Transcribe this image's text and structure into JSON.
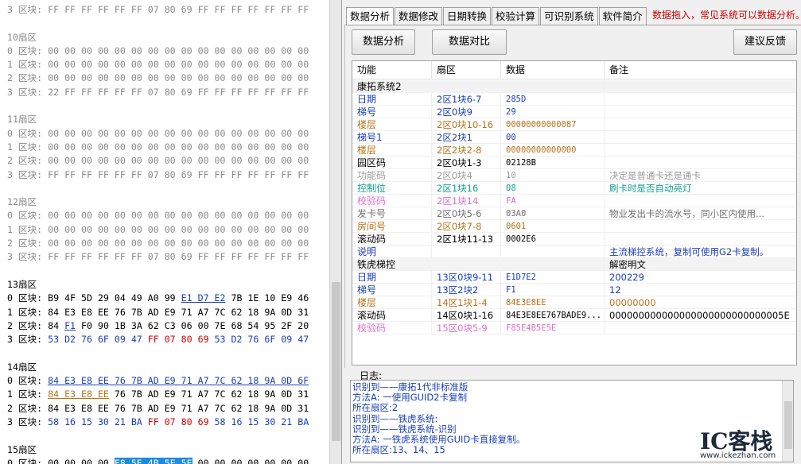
{
  "hex": {
    "lines": [
      {
        "t": "row",
        "label": "3 区块:",
        "bytes": "FF FF FF FF FF FF 07 80 69 FF FF FF FF FF FF FF",
        "style": "gray"
      },
      {
        "t": "blank"
      },
      {
        "t": "sector",
        "label": "10扇区"
      },
      {
        "t": "row",
        "label": "0 区块:",
        "bytes": "00 00 00 00 00 00 00 00 00 00 00 00 00 00 00 00",
        "style": "gray"
      },
      {
        "t": "row",
        "label": "1 区块:",
        "bytes": "00 00 00 00 00 00 00 00 00 00 00 00 00 00 00 00",
        "style": "gray"
      },
      {
        "t": "row",
        "label": "2 区块:",
        "bytes": "00 00 00 00 00 00 00 00 00 00 00 00 00 00 00 00",
        "style": "gray"
      },
      {
        "t": "row",
        "label": "3 区块:",
        "bytes": "22 FF FF FF FF FF 07 80 69 FF FF FF FF FF FF FF",
        "style": "gray"
      },
      {
        "t": "blank"
      },
      {
        "t": "sector",
        "label": "11扇区"
      },
      {
        "t": "row",
        "label": "0 区块:",
        "bytes": "00 00 00 00 00 00 00 00 00 00 00 00 00 00 00 00",
        "style": "gray"
      },
      {
        "t": "row",
        "label": "1 区块:",
        "bytes": "00 00 00 00 00 00 00 00 00 00 00 00 00 00 00 00",
        "style": "gray"
      },
      {
        "t": "row",
        "label": "2 区块:",
        "bytes": "00 00 00 00 00 00 00 00 00 00 00 00 00 00 00 00",
        "style": "gray"
      },
      {
        "t": "row",
        "label": "3 区块:",
        "bytes": "FF FF FF FF FF FF 07 80 69 FF FF FF FF FF FF FF",
        "style": "gray"
      },
      {
        "t": "blank"
      },
      {
        "t": "sector",
        "label": "12扇区"
      },
      {
        "t": "row",
        "label": "0 区块:",
        "bytes": "00 00 00 00 00 00 00 00 00 00 00 00 00 00 00 00",
        "style": "gray"
      },
      {
        "t": "row",
        "label": "1 区块:",
        "bytes": "00 00 00 00 00 00 00 00 00 00 00 00 00 00 00 00",
        "style": "gray"
      },
      {
        "t": "row",
        "label": "2 区块:",
        "bytes": "00 00 00 00 00 00 00 00 00 00 00 00 00 00 00 00",
        "style": "gray"
      },
      {
        "t": "row",
        "label": "3 区块:",
        "bytes": "FF FF FF FF FF FF 07 80 69 FF FF FF FF FF FF FF",
        "style": "gray"
      },
      {
        "t": "blank"
      },
      {
        "t": "sector",
        "label": "13扇区",
        "style": "dark"
      },
      {
        "t": "seg",
        "label": "0 区块:",
        "segs": [
          [
            "B9 4F 5D 29 04 49 A0 99 ",
            ""
          ],
          [
            "E1 D7 E2",
            "ul"
          ],
          [
            " 7B 1E 10 E9 46",
            ""
          ]
        ]
      },
      {
        "t": "seg",
        "label": "1 区块:",
        "segs": [
          [
            "84 E3 E8 EE 76 7B AD E9 71 A7 7C 62 18 9A 0D 31",
            ""
          ]
        ]
      },
      {
        "t": "seg",
        "label": "2 区块:",
        "segs": [
          [
            "84 ",
            ""
          ],
          [
            "F1",
            "ul"
          ],
          [
            " F0 90 1B 3A 62 C3 06 00 7E 68 54 95 2F 20",
            ""
          ]
        ]
      },
      {
        "t": "seg",
        "label": "3 区块:",
        "segs": [
          [
            "53 D2 76 6F 09 47 ",
            "blue"
          ],
          [
            "FF 07 80 69",
            "red"
          ],
          [
            " 53 D2 76 6F 09 47",
            "blue"
          ]
        ]
      },
      {
        "t": "blank"
      },
      {
        "t": "sector",
        "label": "14扇区",
        "style": "dark"
      },
      {
        "t": "seg",
        "label": "0 区块:",
        "segs": [
          [
            "84 E3 E8 EE 76 7B AD E9 71 A7 7C 62 18 9A 0D 6F",
            "ul"
          ]
        ]
      },
      {
        "t": "seg",
        "label": "1 区块:",
        "segs": [
          [
            "84 E3 E8 EE",
            "gold"
          ],
          [
            " 76 7B AD E9 71 A7 7C 62 18 9A 0D 31",
            ""
          ]
        ]
      },
      {
        "t": "seg",
        "label": "2 区块:",
        "segs": [
          [
            "84 E3 E8 EE 76 7B AD E9 71 A7 7C 62 18 9A 0D 31",
            ""
          ]
        ]
      },
      {
        "t": "seg",
        "label": "3 区块:",
        "segs": [
          [
            "58 16 15 30 21 BA ",
            "blue"
          ],
          [
            "FF 07 80 69",
            "red"
          ],
          [
            " 58 16 15 30 21 BA",
            "blue"
          ]
        ]
      },
      {
        "t": "blank"
      },
      {
        "t": "sector",
        "label": "15扇区",
        "style": "dark"
      },
      {
        "t": "seg",
        "label": "0 区块:",
        "segs": [
          [
            "00 00 00 00 ",
            ""
          ],
          [
            "F8 5E 4B 5E 5E",
            "sel"
          ],
          [
            " 00 00 00 00 00 00 00",
            ""
          ]
        ]
      }
    ]
  },
  "tabs": [
    "数据分析",
    "数据修改",
    "日期转换",
    "校验计算",
    "可识别系统",
    "软件简介"
  ],
  "hint": "数据拖入，常见系统可以数据分析。",
  "buttons": {
    "analyze": "数据分析",
    "compare": "数据对比",
    "feedback": "建议反馈"
  },
  "grid": {
    "headers": [
      "功能",
      "扇区",
      "数据",
      "备注"
    ],
    "rows": [
      {
        "section": true,
        "c1": "康拓系统2",
        "color": "#000000"
      },
      {
        "c1": "日期",
        "c2": "2区1块6-7",
        "c3": "285D",
        "c4": "",
        "color": "#1a3fb4"
      },
      {
        "c1": "梯号",
        "c2": "2区0块9",
        "c3": "29",
        "c4": "",
        "color": "#1a3fb4"
      },
      {
        "c1": "楼层",
        "c2": "2区0块10-16",
        "c3": "00000000000087",
        "c4": "",
        "color": "#b8741a"
      },
      {
        "c1": "梯号1",
        "c2": "2区2块1",
        "c3": "00",
        "c4": "",
        "color": "#1a3fb4"
      },
      {
        "c1": "楼层",
        "c2": "2区2块2-8",
        "c3": "00000000000000",
        "c4": "",
        "color": "#b8741a"
      },
      {
        "c1": "园区码",
        "c2": "2区0块1-3",
        "c3": "02128B",
        "c4": "",
        "color": "#000000"
      },
      {
        "c1": "功能码",
        "c2": "2区0块4",
        "c3": "10",
        "c4": "决定是普通卡还是通卡",
        "color": "#9a9a9a"
      },
      {
        "c1": "控制位",
        "c2": "2区1块16",
        "c3": "08",
        "c4": "刷卡时是否自动亮灯",
        "color": "#10a090"
      },
      {
        "c1": "校验码",
        "c2": "2区1块14",
        "c3": "FA",
        "c4": "",
        "color": "#e070d0"
      },
      {
        "c1": "发卡号",
        "c2": "2区0块5-6",
        "c3": "03A0",
        "c4": " 物业发出卡的流水号，同小区内使用...",
        "color": "#707070"
      },
      {
        "c1": "房间号",
        "c2": "2区0块7-8",
        "c3": "0601",
        "c4": "",
        "color": "#b8741a"
      },
      {
        "c1": "滚动码",
        "c2": "2区1块11-13",
        "c3": "0002E6",
        "c4": "",
        "color": "#000000"
      },
      {
        "c1": "说明",
        "c2": "",
        "c3": "",
        "c4": "主流梯控系统，复制可使用G2卡复制。",
        "color": "#1a3fb4"
      },
      {
        "section": true,
        "c1": "铁虎梯控",
        "c4": "解密明文",
        "color": "#000000"
      },
      {
        "c1": "日期",
        "c2": "13区0块9-11",
        "c3": "E1D7E2",
        "c4": "200229",
        "color": "#1a3fb4"
      },
      {
        "c1": "梯号",
        "c2": "13区2块2",
        "c3": "F1",
        "c4": "12",
        "color": "#1a3fb4"
      },
      {
        "c1": "楼层",
        "c2": "14区1块1-4",
        "c3": "84E3E8EE",
        "c4": "00000000",
        "color": "#b8741a"
      },
      {
        "c1": "滚动码",
        "c2": "14区0块1-16",
        "c3": "84E3E8EE767BADE9...",
        "c4": "000000000000000000000000000005E",
        "color": "#000000"
      },
      {
        "c1": "校验码",
        "c2": "15区0块5-9",
        "c3": "F85E4B5E5E",
        "c4": "",
        "color": "#e070d0"
      }
    ]
  },
  "log": {
    "label": "日志:",
    "lines": [
      "识别到——康拓1代非标准版",
      "方法A: 一使用GUID2卡复制",
      "所在扇区:2",
      "识别到——铁虎系统:",
      "识别到——铁虎系统-识别",
      "方法A: 一铁虎系统使用GUID卡直接复制。",
      "所在扇区:13、14、15"
    ]
  },
  "watermark": {
    "main": "IC客栈",
    "url": "www.ickezhan.com"
  },
  "colors": {
    "accent": "#1a3fb4",
    "hint": "#d00000",
    "selection": "#1e8ae0"
  }
}
